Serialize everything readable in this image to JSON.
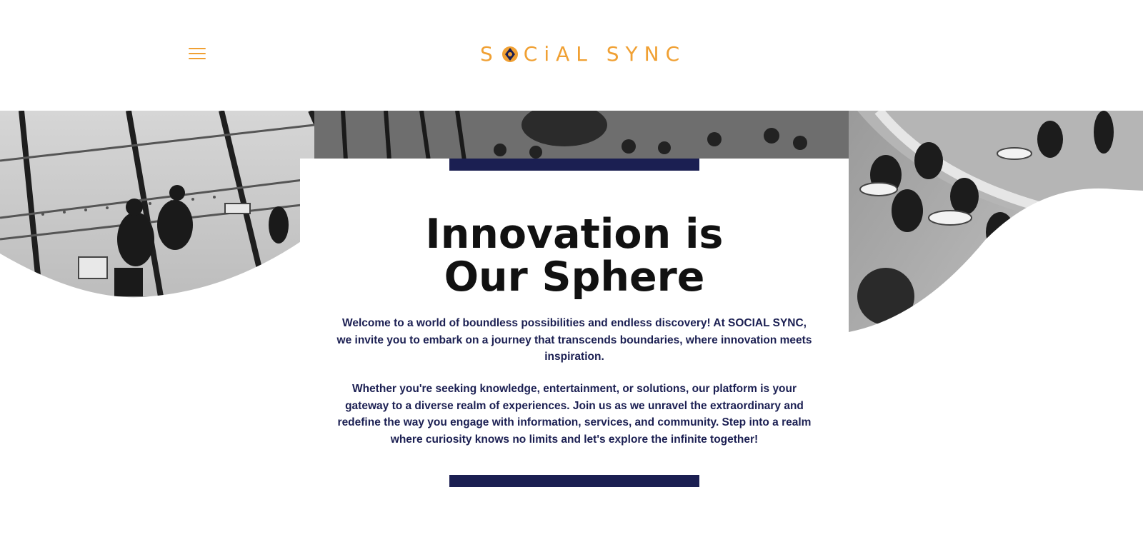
{
  "header": {
    "menu_icon": "hamburger-menu-icon",
    "logo": {
      "text_before": "S",
      "text_after": "CiAL SYNC",
      "color": "#f0a033",
      "mark_color": "#1b1f52"
    }
  },
  "hero": {
    "headline_line1": "Innovation is",
    "headline_line2": "Our Sphere",
    "paragraph1": "Welcome to a world of boundless possibilities and endless discovery! At SOCIAL SYNC, we invite you to embark on a journey that transcends boundaries, where innovation meets inspiration.",
    "paragraph2": "Whether you're seeking knowledge, entertainment, or solutions, our platform is your gateway to a diverse realm of experiences. Join us as we unravel the extraordinary and redefine the way you engage with information, services, and community. Step into a realm where curiosity knows no limits and let's explore the infinite together!",
    "accent_color": "#1b1f52",
    "text_color": "#1b1f52"
  }
}
